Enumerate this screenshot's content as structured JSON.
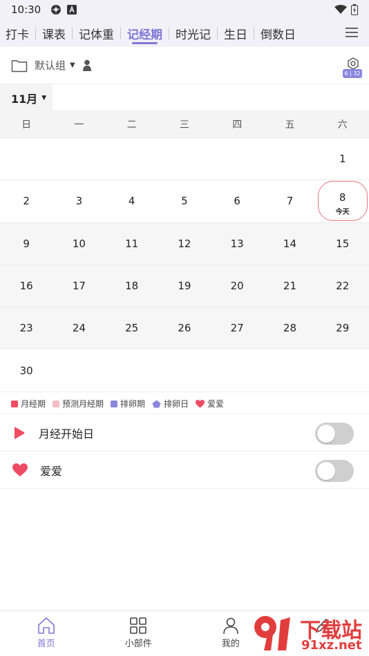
{
  "status_bar": {
    "time": "10:30"
  },
  "tabs": [
    {
      "label": "打卡",
      "active": false
    },
    {
      "label": "课表",
      "active": false
    },
    {
      "label": "记体重",
      "active": false
    },
    {
      "label": "记经期",
      "active": true
    },
    {
      "label": "时光记",
      "active": false
    },
    {
      "label": "生日",
      "active": false
    },
    {
      "label": "倒数日",
      "active": false
    }
  ],
  "group": {
    "label": "默认组",
    "camera_badge": "6 | 32"
  },
  "month": {
    "label": "11月"
  },
  "weekdays": [
    "日",
    "一",
    "二",
    "三",
    "四",
    "五",
    "六"
  ],
  "calendar": {
    "rows": [
      [
        "",
        "",
        "",
        "",
        "",
        "",
        "1"
      ],
      [
        "2",
        "3",
        "4",
        "5",
        "6",
        "7",
        "8"
      ],
      [
        "9",
        "10",
        "11",
        "12",
        "13",
        "14",
        "15"
      ],
      [
        "16",
        "17",
        "18",
        "19",
        "20",
        "21",
        "22"
      ],
      [
        "23",
        "24",
        "25",
        "26",
        "27",
        "28",
        "29"
      ],
      [
        "30",
        "",
        "",
        "",
        "",
        "",
        ""
      ]
    ],
    "today": "8",
    "today_label": "今天"
  },
  "legend": [
    {
      "label": "月经期",
      "color": "#ee4c63",
      "shape": "square"
    },
    {
      "label": "预测月经期",
      "color": "#f7bcc4",
      "shape": "square"
    },
    {
      "label": "排卵期",
      "color": "#8a86de",
      "shape": "square"
    },
    {
      "label": "排卵日",
      "color": "#8a86de",
      "shape": "pentagon"
    },
    {
      "label": "爱爱",
      "color": "#ee4c63",
      "shape": "heart"
    }
  ],
  "toggles": [
    {
      "label": "月经开始日",
      "on": false,
      "icon": "play-flag-icon"
    },
    {
      "label": "爱爱",
      "on": false,
      "icon": "heart-icon"
    }
  ],
  "bottom_nav": [
    {
      "label": "首页",
      "active": true,
      "icon": "home-icon"
    },
    {
      "label": "小部件",
      "active": false,
      "icon": "grid-icon"
    },
    {
      "label": "我的",
      "active": false,
      "icon": "user-icon"
    },
    {
      "label": "",
      "active": false,
      "icon": "edit-icon"
    }
  ],
  "watermark": {
    "text": "下载站",
    "subtext": "91xz.net"
  },
  "colors": {
    "accent": "#7f77d6",
    "period": "#ee4c63",
    "today_ring": "#e9717f"
  }
}
